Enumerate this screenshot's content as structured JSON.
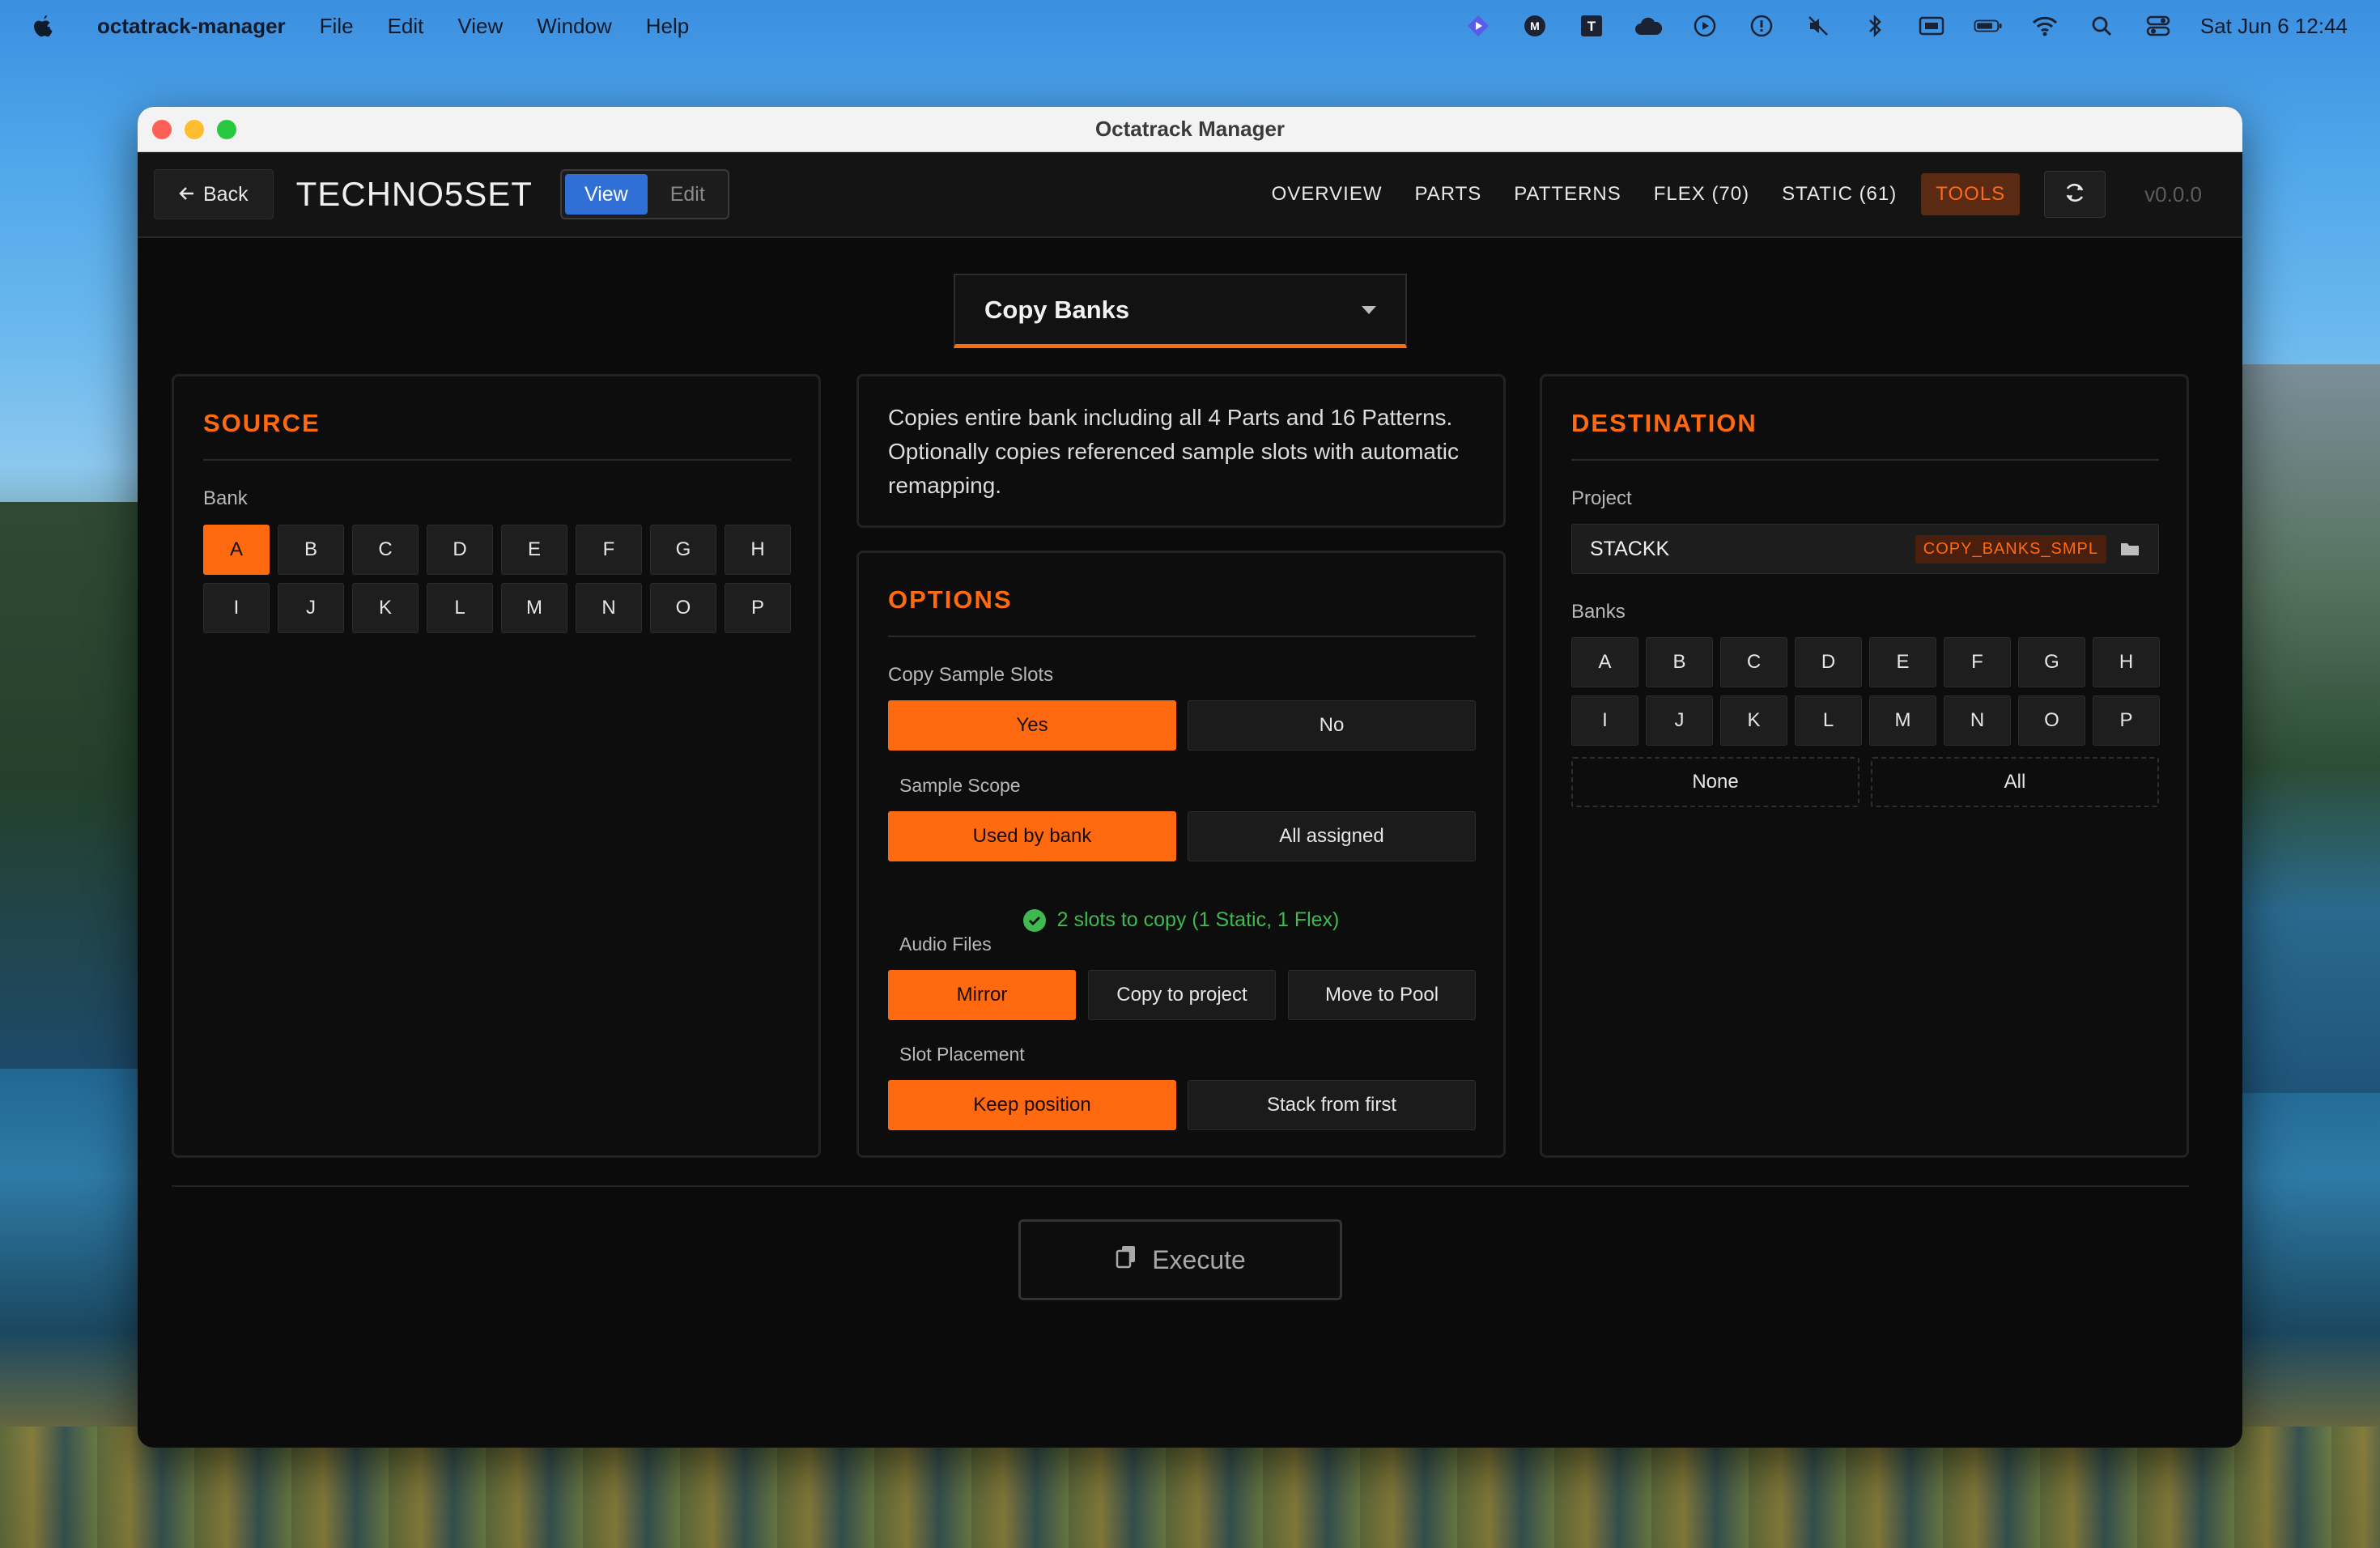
{
  "menubar": {
    "app_name": "octatrack-manager",
    "items": [
      "File",
      "Edit",
      "View",
      "Window",
      "Help"
    ],
    "clock": "Sat Jun 6  12:44",
    "status_icons": [
      "linear-icon",
      "m-icon",
      "t-icon",
      "cloud-icon",
      "play-circle-icon",
      "alert-circle-icon",
      "mute-icon",
      "bluetooth-icon",
      "display-icon",
      "battery-icon",
      "wifi-icon",
      "search-icon",
      "control-center-icon"
    ]
  },
  "window": {
    "title": "Octatrack Manager"
  },
  "header": {
    "back_label": "Back",
    "project_name": "TECHNO5SET",
    "mode": {
      "view": "View",
      "edit": "Edit",
      "active": "View"
    },
    "nav": [
      "OVERVIEW",
      "PARTS",
      "PATTERNS",
      "FLEX (70)",
      "STATIC (61)",
      "TOOLS"
    ],
    "active_nav": "TOOLS",
    "version": "v0.0.0"
  },
  "tool": {
    "selected": "Copy Banks"
  },
  "source": {
    "title": "SOURCE",
    "bank_label": "Bank",
    "banks": [
      "A",
      "B",
      "C",
      "D",
      "E",
      "F",
      "G",
      "H",
      "I",
      "J",
      "K",
      "L",
      "M",
      "N",
      "O",
      "P"
    ],
    "selected": "A"
  },
  "description": "Copies entire bank including all 4 Parts and 16 Patterns. Optionally copies referenced sample slots with automatic remapping.",
  "options": {
    "title": "OPTIONS",
    "copy_sample_slots": {
      "label": "Copy Sample Slots",
      "yes": "Yes",
      "no": "No",
      "selected": "Yes"
    },
    "sample_scope": {
      "label": "Sample Scope",
      "used": "Used by bank",
      "all": "All assigned",
      "selected": "Used by bank"
    },
    "summary": "2 slots to copy (1 Static, 1 Flex)",
    "audio_files": {
      "label": "Audio Files",
      "mirror": "Mirror",
      "copy": "Copy to project",
      "move": "Move to Pool",
      "selected": "Mirror"
    },
    "slot_placement": {
      "label": "Slot Placement",
      "keep": "Keep position",
      "stack": "Stack from first",
      "selected": "Keep position"
    }
  },
  "destination": {
    "title": "DESTINATION",
    "project_label": "Project",
    "project_name": "STACKK",
    "project_tag": "COPY_BANKS_SMPL",
    "banks_label": "Banks",
    "banks": [
      "A",
      "B",
      "C",
      "D",
      "E",
      "F",
      "G",
      "H",
      "I",
      "J",
      "K",
      "L",
      "M",
      "N",
      "O",
      "P"
    ],
    "none_label": "None",
    "all_label": "All"
  },
  "execute_label": "Execute",
  "colors": {
    "accent": "#ff6a10",
    "success": "#3fb950",
    "view_active": "#2f6fd6"
  }
}
